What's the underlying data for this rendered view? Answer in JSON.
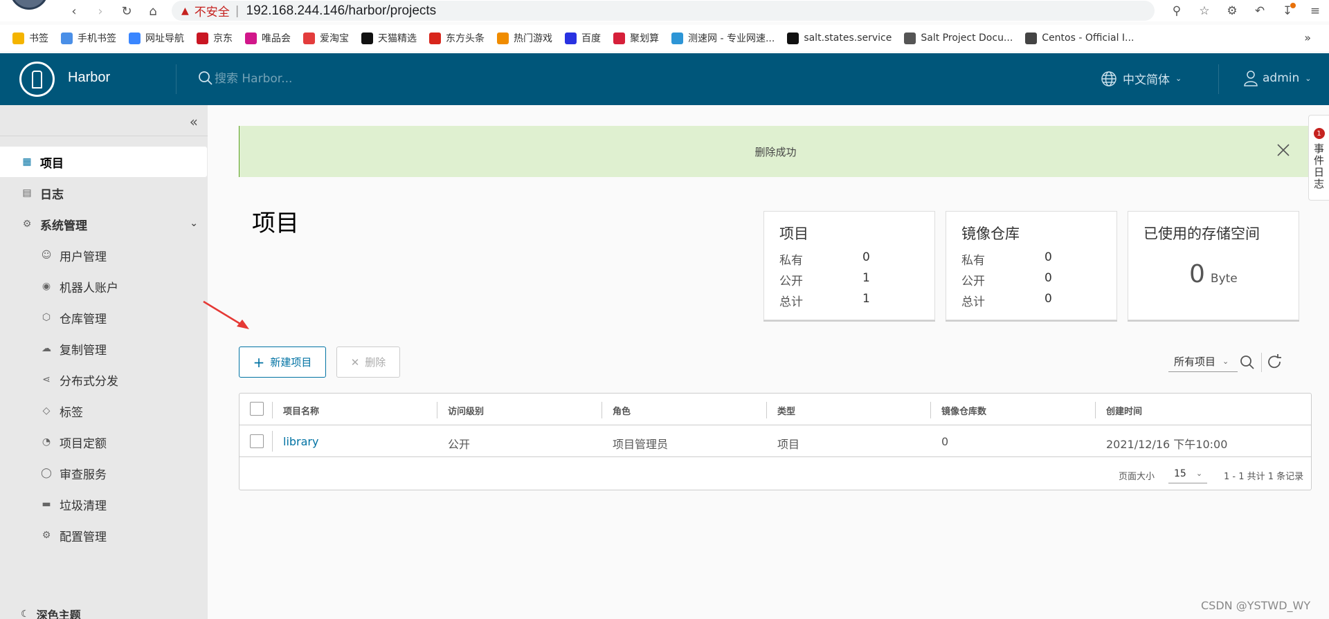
{
  "browser": {
    "insecure_label": "不安全",
    "separator": "|",
    "url": "192.168.244.146/harbor/projects"
  },
  "bookmarks": [
    {
      "label": "书签",
      "icon": "star-icon",
      "color": "#f4b400"
    },
    {
      "label": "手机书签",
      "icon": "phone-icon",
      "color": "#4a8fe7"
    },
    {
      "label": "网址导航",
      "icon": "nav-icon",
      "color": "#3a86ff"
    },
    {
      "label": "京东",
      "icon": "jd-icon",
      "color": "#c91623"
    },
    {
      "label": "唯品会",
      "icon": "vip-icon",
      "color": "#d1178a"
    },
    {
      "label": "爱淘宝",
      "icon": "taobao-icon",
      "color": "#e33c3c"
    },
    {
      "label": "天猫精选",
      "icon": "tmall-icon",
      "color": "#111111"
    },
    {
      "label": "东方头条",
      "icon": "dftt-icon",
      "color": "#d8261c"
    },
    {
      "label": "热门游戏",
      "icon": "game-icon",
      "color": "#f08c00"
    },
    {
      "label": "百度",
      "icon": "baidu-icon",
      "color": "#2932e1"
    },
    {
      "label": "聚划算",
      "icon": "jhs-icon",
      "color": "#d6203a"
    },
    {
      "label": "测速网 - 专业网速...",
      "icon": "speed-icon",
      "color": "#2d95d6"
    },
    {
      "label": "salt.states.service",
      "icon": "salt-icon",
      "color": "#111111"
    },
    {
      "label": "Salt Project Docu...",
      "icon": "saltproject-icon",
      "color": "#555555"
    },
    {
      "label": "Centos - Official I...",
      "icon": "centos-icon",
      "color": "#444444"
    }
  ],
  "header": {
    "brand": "Harbor",
    "search_placeholder": "搜索 Harbor...",
    "language": "中文简体",
    "user": "admin",
    "bg_color": "#00567a"
  },
  "sidebar": {
    "items": [
      {
        "label": "项目",
        "icon": "projects-icon"
      },
      {
        "label": "日志",
        "icon": "logs-icon"
      },
      {
        "label": "系统管理",
        "icon": "admin-icon"
      },
      {
        "label": "用户管理",
        "icon": "users-icon"
      },
      {
        "label": "机器人账户",
        "icon": "robot-icon"
      },
      {
        "label": "仓库管理",
        "icon": "registry-icon"
      },
      {
        "label": "复制管理",
        "icon": "replication-icon"
      },
      {
        "label": "分布式分发",
        "icon": "distribution-icon"
      },
      {
        "label": "标签",
        "icon": "tag-icon"
      },
      {
        "label": "项目定额",
        "icon": "quota-icon"
      },
      {
        "label": "审查服务",
        "icon": "scanner-icon"
      },
      {
        "label": "垃圾清理",
        "icon": "trash-icon"
      },
      {
        "label": "配置管理",
        "icon": "config-icon"
      }
    ],
    "theme_toggle": "深色主题"
  },
  "alert": {
    "message": "删除成功"
  },
  "page": {
    "title": "项目"
  },
  "cards": {
    "projects": {
      "title": "项目",
      "rows": [
        {
          "label": "私有",
          "value": "0"
        },
        {
          "label": "公开",
          "value": "1"
        },
        {
          "label": "总计",
          "value": "1"
        }
      ]
    },
    "repos": {
      "title": "镜像仓库",
      "rows": [
        {
          "label": "私有",
          "value": "0"
        },
        {
          "label": "公开",
          "value": "0"
        },
        {
          "label": "总计",
          "value": "0"
        }
      ]
    },
    "storage": {
      "title": "已使用的存储空间",
      "value": "0",
      "unit": "Byte"
    }
  },
  "toolbar": {
    "new_project": "新建项目",
    "delete": "删除",
    "filter": "所有项目"
  },
  "table": {
    "columns": [
      "项目名称",
      "访问级别",
      "角色",
      "类型",
      "镜像仓库数",
      "创建时间"
    ],
    "rows": [
      {
        "name": "library",
        "access": "公开",
        "role": "项目管理员",
        "type": "项目",
        "repo_count": "0",
        "created": "2021/12/16 下午10:00"
      }
    ],
    "page_size_label": "页面大小",
    "page_size": "15",
    "summary": "1 - 1 共计 1 条记录"
  },
  "right_tab": {
    "badge": "1",
    "label": "事件日志"
  },
  "watermark": "CSDN @YSTWD_WY"
}
